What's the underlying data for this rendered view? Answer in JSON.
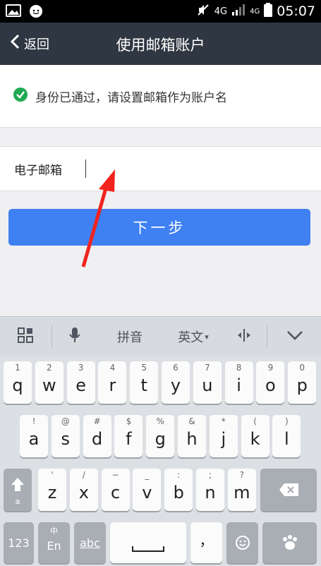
{
  "status": {
    "network": "4G",
    "network2": "4G",
    "time": "05:07"
  },
  "nav": {
    "back_label": "返回",
    "title": "使用邮箱账户"
  },
  "verified": {
    "text": "身份已通过，请设置邮箱作为账户名"
  },
  "email": {
    "label": "电子邮箱",
    "value": "",
    "placeholder": ""
  },
  "next_label": "下一步",
  "keyboard": {
    "toolbar": {
      "pinyin": "拼音",
      "english": "英文"
    },
    "row1": [
      {
        "n": "1",
        "c": "q"
      },
      {
        "n": "2",
        "c": "w"
      },
      {
        "n": "3",
        "c": "e"
      },
      {
        "n": "4",
        "c": "r"
      },
      {
        "n": "5",
        "c": "t"
      },
      {
        "n": "6",
        "c": "y"
      },
      {
        "n": "7",
        "c": "u"
      },
      {
        "n": "8",
        "c": "i"
      },
      {
        "n": "9",
        "c": "o"
      },
      {
        "n": "0",
        "c": "p"
      }
    ],
    "row2": [
      {
        "n": "!",
        "c": "a"
      },
      {
        "n": "@",
        "c": "s"
      },
      {
        "n": "#",
        "c": "d"
      },
      {
        "n": "$",
        "c": "f"
      },
      {
        "n": "%",
        "c": "g"
      },
      {
        "n": "&",
        "c": "h"
      },
      {
        "n": "*",
        "c": "j"
      },
      {
        "n": "(",
        "c": "k"
      },
      {
        "n": ")",
        "c": "l"
      }
    ],
    "row3": [
      {
        "n": "'",
        "c": "z"
      },
      {
        "n": "/",
        "c": "x"
      },
      {
        "n": "−",
        "c": "c"
      },
      {
        "n": "_",
        "c": "v"
      },
      {
        "n": ":",
        "c": "b"
      },
      {
        "n": ";",
        "c": "n"
      },
      {
        "n": "?",
        "c": "m"
      }
    ],
    "shift_sub": "a",
    "num_label": "123",
    "lang_top": "中",
    "lang_label": "En",
    "abc_label": "abc",
    "comma_label": "，"
  }
}
